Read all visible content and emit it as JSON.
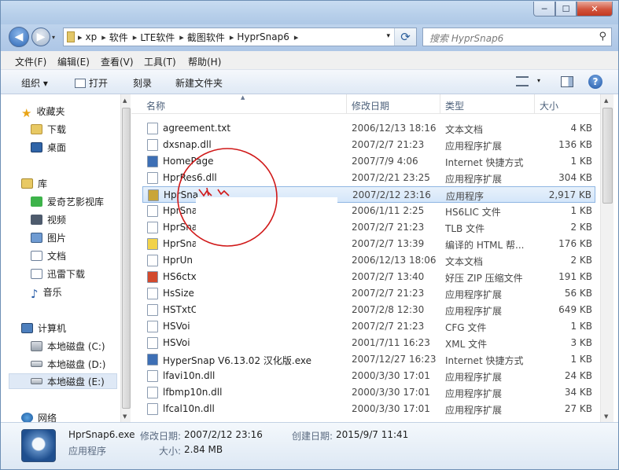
{
  "window": {
    "min": "─",
    "max": "☐",
    "close": "✕"
  },
  "nav": {
    "back": "◀",
    "forward": "▶",
    "dropdown": "▾",
    "refresh": "⟳",
    "breadcrumbs": [
      "xp",
      "软件",
      "LTE软件",
      "截图软件",
      "HyprSnap6"
    ],
    "breadcrumb_sep": "▸",
    "search_placeholder": "搜索 HyprSnap6",
    "search_icon": "search-icon"
  },
  "menu": [
    "文件(F)",
    "编辑(E)",
    "查看(V)",
    "工具(T)",
    "帮助(H)"
  ],
  "toolbar": {
    "organize": "组织 ▾",
    "open": "打开",
    "burn": "刻录",
    "new_folder": "新建文件夹",
    "view_drop": "▾",
    "help": "?"
  },
  "sidebar": {
    "favorites": {
      "label": "收藏夹",
      "items": [
        "下载",
        "桌面"
      ]
    },
    "libraries": {
      "label": "库",
      "items": [
        "爱奇艺影视库",
        "视频",
        "图片",
        "文档",
        "迅雷下载",
        "音乐"
      ]
    },
    "computer": {
      "label": "计算机",
      "items": [
        "本地磁盘 (C:)",
        "本地磁盘 (D:)",
        "本地磁盘 (E:)"
      ]
    },
    "network": {
      "label": "网络"
    }
  },
  "columns": {
    "name": "名称",
    "date": "修改日期",
    "type": "类型",
    "size": "大小"
  },
  "files": [
    {
      "name": "agreement.txt",
      "date": "2006/12/13 18:16",
      "type": "文本文档",
      "size": "4 KB"
    },
    {
      "name": "dxsnap.dll",
      "date": "2007/2/7 21:23",
      "type": "应用程序扩展",
      "size": "136 KB"
    },
    {
      "name": "HomePage",
      "date": "2007/7/9 4:06",
      "type": "Internet 快捷方式",
      "size": "1 KB"
    },
    {
      "name": "HprRes6.dll",
      "date": "2007/2/21 23:25",
      "type": "应用程序扩展",
      "size": "304 KB"
    },
    {
      "name": "HprSna",
      "date": "2007/2/12 23:16",
      "type": "应用程序",
      "size": "2,917 KB"
    },
    {
      "name": "HprSna",
      "date": "2006/1/11 2:25",
      "type": "HS6LIC 文件",
      "size": "1 KB"
    },
    {
      "name": "HprSna",
      "date": "2007/2/7 21:23",
      "type": "TLB 文件",
      "size": "2 KB"
    },
    {
      "name": "HprSna",
      "date": "2007/2/7 13:39",
      "type": "编译的 HTML 帮...",
      "size": "176 KB"
    },
    {
      "name": "HprUn",
      "date": "2006/12/13 18:06",
      "type": "文本文档",
      "size": "2 KB"
    },
    {
      "name": "HS6ctx",
      "date": "2007/2/7 13:40",
      "type": "好压 ZIP 压缩文件",
      "size": "191 KB"
    },
    {
      "name": "HsSize",
      "date": "2007/2/7 21:23",
      "type": "应用程序扩展",
      "size": "56 KB"
    },
    {
      "name": "HSTxtO",
      "date": "2007/2/8 12:30",
      "type": "应用程序扩展",
      "size": "649 KB"
    },
    {
      "name": "HSVoi",
      "date": "2007/2/7 21:23",
      "type": "CFG 文件",
      "size": "1 KB"
    },
    {
      "name": "HSVoi",
      "date": "2001/7/11 16:23",
      "type": "XML 文件",
      "size": "3 KB"
    },
    {
      "name": "HyperSnap V6.13.02 汉化版.exe",
      "date": "2007/12/27 16:23",
      "type": "Internet 快捷方式",
      "size": "1 KB"
    },
    {
      "name": "lfavi10n.dll",
      "date": "2000/3/30 17:01",
      "type": "应用程序扩展",
      "size": "24 KB"
    },
    {
      "name": "lfbmp10n.dll",
      "date": "2000/3/30 17:01",
      "type": "应用程序扩展",
      "size": "34 KB"
    },
    {
      "name": "lfcal10n.dll",
      "date": "2000/3/30 17:01",
      "type": "应用程序扩展",
      "size": "27 KB"
    }
  ],
  "details": {
    "filename": "HprSnap6.exe",
    "modified_label": "修改日期:",
    "modified": "2007/2/12 23:16",
    "created_label": "创建日期:",
    "created": "2015/9/7 11:41",
    "type": "应用程序",
    "size_label": "大小:",
    "size": "2.84 MB"
  },
  "colors": {
    "selection": "#d4e6fa",
    "scribble": "#d01818",
    "accent": "#2d67b6"
  }
}
